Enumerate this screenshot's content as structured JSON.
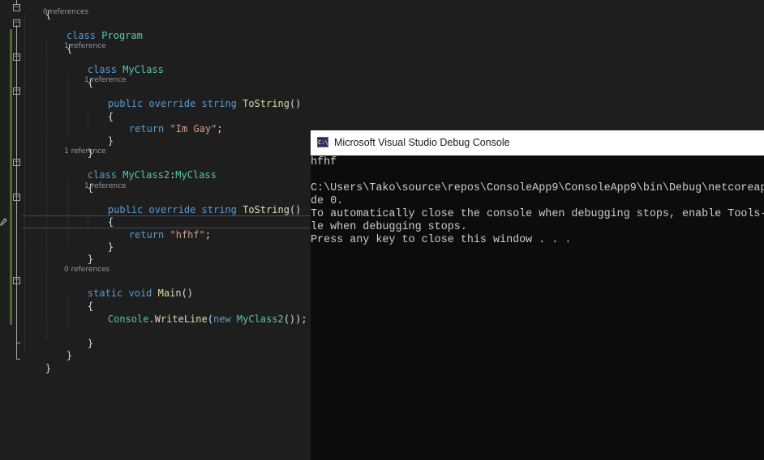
{
  "code": {
    "open_brace": "{",
    "lens_program": "0 references",
    "kw_class": "class",
    "class_program": "Program",
    "lens_myclass": "1 reference",
    "class_myclass": "MyClass",
    "lens_tostring1": "1 reference",
    "kw_public": "public",
    "kw_override": "override",
    "kw_string": "string",
    "method_tostring": "ToString",
    "parens": "()",
    "kw_return": "return",
    "str_im_gay": "\"Im Gay\"",
    "semicolon": ";",
    "close_brace": "}",
    "lens_myclass2": "1 reference",
    "class_myclass2": "MyClass2",
    "colon": ":",
    "lens_tostring2": "1 reference",
    "str_hfhf": "\"hfhf\"",
    "lens_main": "0 references",
    "kw_static": "static",
    "kw_void": "void",
    "method_main": "Main",
    "type_console": "Console",
    "dot": ".",
    "method_writeline": "WriteLine",
    "open_paren": "(",
    "kw_new": "new",
    "close_call": "());"
  },
  "console": {
    "title": "Microsoft Visual Studio Debug Console",
    "icon_text": "C:\\",
    "lines": [
      "hfhf",
      "",
      "C:\\Users\\Tako\\source\\repos\\ConsoleApp9\\ConsoleApp9\\bin\\Debug\\netcoreap",
      "de 0.",
      "To automatically close the console when debugging stops, enable Tools-",
      "le when debugging stops.",
      "Press any key to close this window . . ."
    ]
  },
  "colors": {
    "editor_bg": "#1e1e1e",
    "keyword": "#569cd6",
    "type": "#4ec9b0",
    "method": "#dcdcaa",
    "string": "#d69d85",
    "console_bg": "#0c0c0c"
  }
}
